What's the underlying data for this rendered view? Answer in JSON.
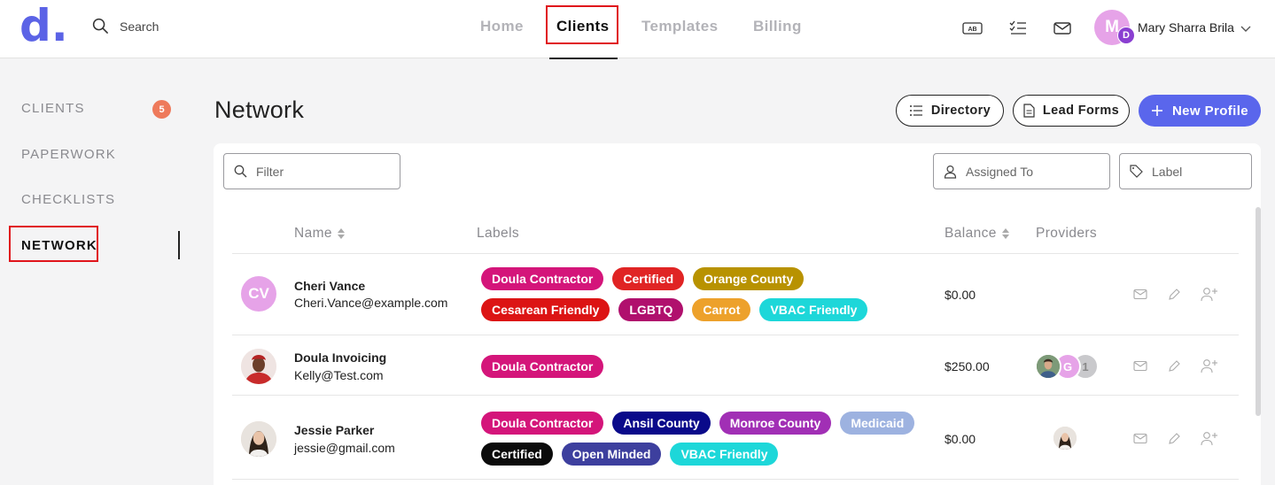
{
  "header": {
    "logo_text": "d",
    "search_label": "Search",
    "nav": [
      {
        "label": "Home",
        "active": false
      },
      {
        "label": "Clients",
        "active": true
      },
      {
        "label": "Templates",
        "active": false
      },
      {
        "label": "Billing",
        "active": false
      }
    ],
    "icons": [
      "ab-badge-icon",
      "checklist-icon",
      "mail-icon"
    ],
    "ab_badge_text": "AB",
    "user": {
      "initial": "M",
      "sub_initial": "D",
      "name": "Mary Sharra Brila"
    }
  },
  "sidebar": {
    "items": [
      {
        "label": "CLIENTS",
        "badge": "5"
      },
      {
        "label": "PAPERWORK"
      },
      {
        "label": "CHECKLISTS"
      },
      {
        "label": "NETWORK",
        "active": true
      }
    ]
  },
  "page": {
    "title": "Network",
    "buttons": {
      "directory": "Directory",
      "lead_forms": "Lead Forms",
      "new_profile": "New Profile"
    },
    "filters": {
      "filter_placeholder": "Filter",
      "assigned_placeholder": "Assigned To",
      "label_placeholder": "Label"
    }
  },
  "table": {
    "columns": {
      "name": "Name",
      "labels": "Labels",
      "balance": "Balance",
      "providers": "Providers"
    },
    "rows": [
      {
        "initials": "CV",
        "avatar_color": "#e6a3e8",
        "name": "Cheri Vance",
        "email": "Cheri.Vance@example.com",
        "labels": [
          {
            "text": "Doula Contractor",
            "color": "#d4157a"
          },
          {
            "text": "Certified",
            "color": "#e02424"
          },
          {
            "text": "Orange County",
            "color": "#b89200"
          },
          {
            "text": "Cesarean Friendly",
            "color": "#dc1414"
          },
          {
            "text": "LGBTQ",
            "color": "#b0106d"
          },
          {
            "text": "Carrot",
            "color": "#eda12b"
          },
          {
            "text": "VBAC Friendly",
            "color": "#1dd7d9"
          }
        ],
        "balance": "$0.00",
        "providers": []
      },
      {
        "initials": "",
        "avatar_color": "#c0392b",
        "name": "Doula  Invoicing",
        "email": "Kelly@Test.com",
        "labels": [
          {
            "text": "Doula Contractor",
            "color": "#d4157a"
          }
        ],
        "balance": "$250.00",
        "providers": [
          {
            "type": "photo",
            "color": "#6d8a5e"
          },
          {
            "type": "initial",
            "text": "G",
            "color": "#e6a3e8"
          },
          {
            "type": "count",
            "text": "1",
            "color": "#c9c9cc"
          }
        ]
      },
      {
        "initials": "",
        "avatar_color": "#e6d6c8",
        "name": "Jessie Parker",
        "email": "jessie@gmail.com",
        "labels": [
          {
            "text": "Doula Contractor",
            "color": "#d4157a"
          },
          {
            "text": "Ansil County",
            "color": "#0a0a8a"
          },
          {
            "text": "Monroe County",
            "color": "#a12fb5"
          },
          {
            "text": "Medicaid",
            "color": "#9db2e0"
          },
          {
            "text": "Certified",
            "color": "#0b0b0b"
          },
          {
            "text": "Open Minded",
            "color": "#3d3f9e"
          },
          {
            "text": "VBAC Friendly",
            "color": "#1dd7d9"
          }
        ],
        "balance": "$0.00",
        "providers": [
          {
            "type": "photo",
            "color": "#e6d6c8"
          }
        ]
      }
    ]
  },
  "colors": {
    "brand": "#5b63e6",
    "primary_button": "#5a66ec",
    "highlight": "#e0141b",
    "badge": "#ee7a5b"
  }
}
